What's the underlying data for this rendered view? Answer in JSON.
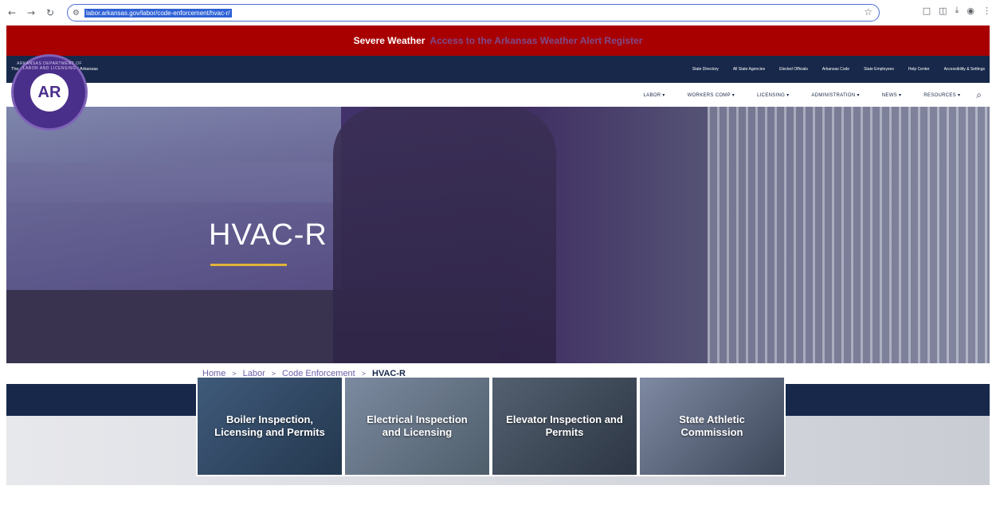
{
  "browser": {
    "url": "labor.arkansas.gov/labor/code-enforcement/hvac-r/",
    "site_info_icon": "tune-icon",
    "bookmark_icon": "star-icon"
  },
  "alert": {
    "label": "Severe Weather",
    "link_text": "Access to the Arkansas Weather Alert Register"
  },
  "state_bar": {
    "official_text": "The Official Website of the State of Arkansas",
    "links": [
      "State Directory",
      "All State Agencies",
      "Elected Officials",
      "Arkansas Code",
      "State Employees",
      "Help Center",
      "Accessibility & Settings"
    ]
  },
  "logo": {
    "text": "AR",
    "ring_text": "ARKANSAS DEPARTMENT OF LABOR AND LICENSING"
  },
  "main_nav": {
    "items": [
      "LABOR ▾",
      "WORKERS COMP ▾",
      "LICENSING ▾",
      "ADMINISTRATION ▾",
      "NEWS ▾",
      "RESOURCES ▾"
    ],
    "search_icon": "search-icon"
  },
  "hero": {
    "title": "HVAC-R"
  },
  "breadcrumb": {
    "items": [
      "Home",
      "Labor",
      "Code Enforcement"
    ],
    "separator": ">",
    "current": "HVAC-R"
  },
  "cards": [
    {
      "label": "Boiler Inspection, Licensing and Permits"
    },
    {
      "label": "Electrical Inspection and Licensing"
    },
    {
      "label": "Elevator Inspection and Permits"
    },
    {
      "label": "State Athletic Commission"
    }
  ],
  "colors": {
    "alert_bg": "#a80000",
    "navy": "#17284a",
    "purple": "#4a2f8a",
    "gold": "#e0b43a"
  }
}
